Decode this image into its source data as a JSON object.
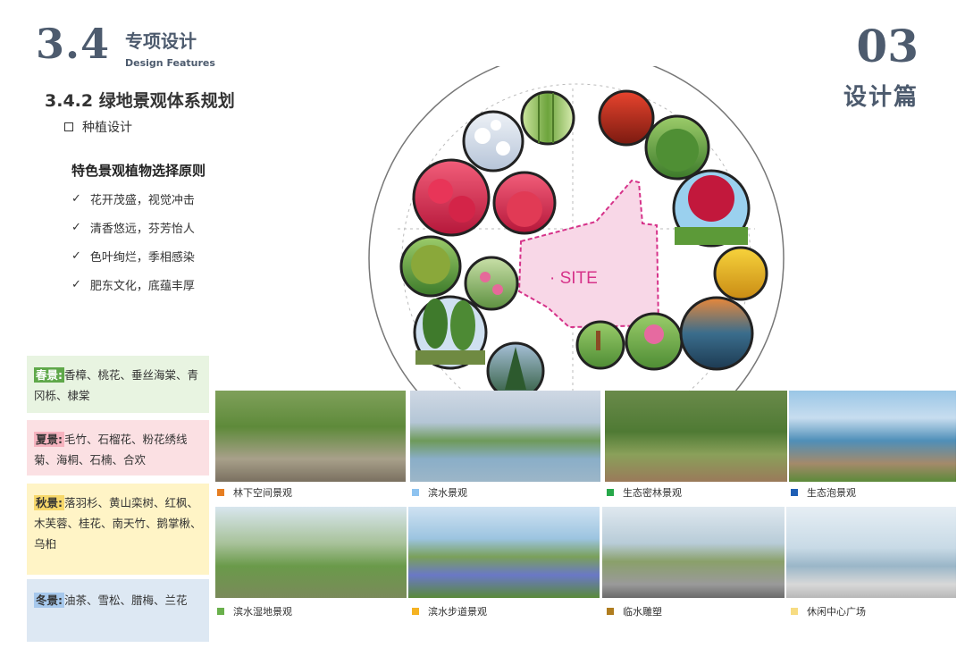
{
  "header": {
    "section_number": "3.4",
    "section_title": "专项设计",
    "section_subtitle": "Design Features",
    "chapter_number": "03",
    "chapter_name": "设计篇"
  },
  "subsection": {
    "title": "3.4.2 绿地景观体系规划",
    "item": "种植设计"
  },
  "principles": {
    "title": "特色景观植物选择原则",
    "items": [
      "花开茂盛，视觉冲击",
      "清香悠远，芬芳怡人",
      "色叶绚烂，季相感染",
      "肥东文化，底蕴丰厚"
    ]
  },
  "seasons": [
    {
      "tag": "春景:",
      "text": "香樟、桃花、垂丝海棠、青冈栎、棣棠",
      "color": "#5fa84a"
    },
    {
      "tag": "夏景:",
      "text": "毛竹、石榴花、粉花绣线菊、海桐、石楠、合欢",
      "color": "#f6b3bf"
    },
    {
      "tag": "秋景:",
      "text": "落羽杉、黄山栾树、红枫、木芙蓉、桂花、南天竹、鹅掌楸、乌桕",
      "color": "#f7d86a"
    },
    {
      "tag": "冬景:",
      "text": "油茶、雪松、腊梅、兰花",
      "color": "#a6c8ec"
    }
  ],
  "diagram": {
    "site_label": "· SITE",
    "site_color": "#d6338a"
  },
  "gallery": [
    {
      "caption": "林下空间景观",
      "color": "#e67e22"
    },
    {
      "caption": "滨水景观",
      "color": "#8ec3f0"
    },
    {
      "caption": "生态密林景观",
      "color": "#27a84a"
    },
    {
      "caption": "生态泡景观",
      "color": "#1f5fb5"
    },
    {
      "caption": "滨水湿地景观",
      "color": "#6ab04c"
    },
    {
      "caption": "滨水步道景观",
      "color": "#f5b323"
    },
    {
      "caption": "临水雕塑",
      "color": "#b07d1f"
    },
    {
      "caption": "休闲中心广场",
      "color": "#f7dc82"
    }
  ]
}
